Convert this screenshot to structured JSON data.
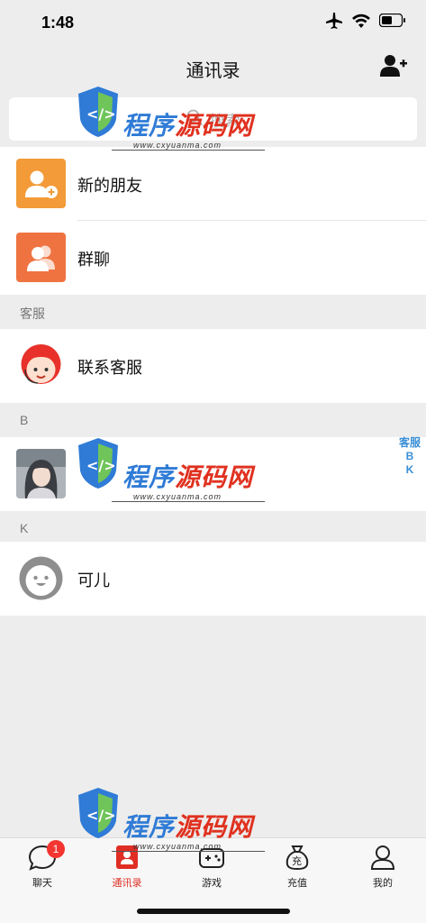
{
  "status_bar": {
    "time": "1:48",
    "icons": [
      "airplane-icon",
      "wifi-icon",
      "battery-icon"
    ]
  },
  "nav": {
    "title": "通讯录",
    "add_friend_icon": "add-contact-icon"
  },
  "search": {
    "placeholder": "搜索"
  },
  "menu_items": [
    {
      "label": "新的朋友",
      "icon": "add-user-icon",
      "color": "#f29b38"
    },
    {
      "label": "群聊",
      "icon": "group-icon",
      "color": "#ef7340"
    }
  ],
  "sections": [
    {
      "header": "客服",
      "items": [
        {
          "label": "联系客服",
          "avatar": "customer-service-avatar"
        }
      ]
    },
    {
      "header": "B",
      "items": [
        {
          "label": "",
          "avatar": "photo-avatar"
        }
      ]
    },
    {
      "header": "K",
      "items": [
        {
          "label": "可儿",
          "avatar": "default-avatar"
        }
      ]
    }
  ],
  "index_bar": [
    "客服",
    "B",
    "K"
  ],
  "watermark": {
    "title_part1": "程序",
    "title_part2": "源码网",
    "url": "www.cxyuanma.com"
  },
  "tabs": [
    {
      "label": "聊天",
      "icon": "chat-icon",
      "badge": "1"
    },
    {
      "label": "通讯录",
      "icon": "contacts-icon",
      "active": true
    },
    {
      "label": "游戏",
      "icon": "game-icon"
    },
    {
      "label": "充值",
      "icon": "recharge-icon"
    },
    {
      "label": "我的",
      "icon": "profile-icon"
    }
  ],
  "colors": {
    "accent_red": "#e02e24",
    "index_blue": "#3a8fd6",
    "badge_red": "#f43530"
  }
}
